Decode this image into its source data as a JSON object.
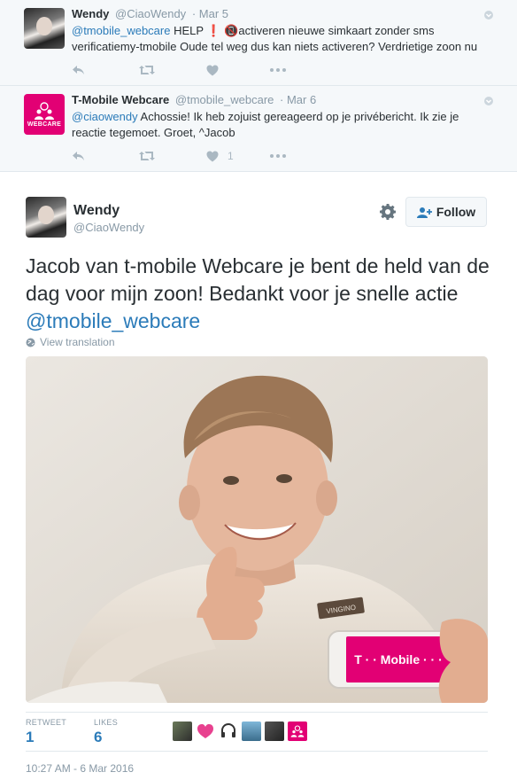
{
  "replies": [
    {
      "name": "Wendy",
      "handle": "@CiaoWendy",
      "date": "· Mar 5",
      "text_mention": "@tmobile_webcare",
      "text_rest": " HELP ❗ 📵activeren nieuwe simkaart zonder sms verificatiemy-tmobile Oude tel weg dus kan niets activeren? Verdrietige zoon nu",
      "like_count": ""
    },
    {
      "name": "T-Mobile Webcare",
      "handle": "@tmobile_webcare",
      "date": "· Mar 6",
      "text_mention": "@ciaowendy",
      "text_rest": " Achossie! Ik heb zojuist gereageerd op je privébericht. Ik zie je reactie tegemoet. Groet, ^Jacob",
      "like_count": "1",
      "avatar_label": "WEBCARE"
    }
  ],
  "main_tweet": {
    "name": "Wendy",
    "handle": "@CiaoWendy",
    "follow_label": "Follow",
    "text": "Jacob van t-mobile Webcare je bent de held van de dag voor mijn zoon! Bedankt voor je snelle actie ",
    "text_mention": "@tmobile_webcare",
    "translate_label": "View translation",
    "photo": {
      "shirt_text": "VINGINO",
      "phone_logo": "T · · Mobile · · ·"
    },
    "stats": {
      "retweets_label": "RETWEET",
      "retweets_value": "1",
      "likes_label": "LIKES",
      "likes_value": "6"
    },
    "timestamp": "10:27 AM - 6 Mar 2016"
  },
  "colors": {
    "link": "#2b7bb9",
    "muted": "#8899a6",
    "icon": "#aab8c2",
    "brand_magenta": "#e20074",
    "reply_bg": "#f5f8fa"
  },
  "icons": [
    "reply-icon",
    "retweet-icon",
    "heart-icon",
    "more-icon",
    "caret-icon",
    "gear-icon",
    "follow-person-icon",
    "globe-icon"
  ]
}
